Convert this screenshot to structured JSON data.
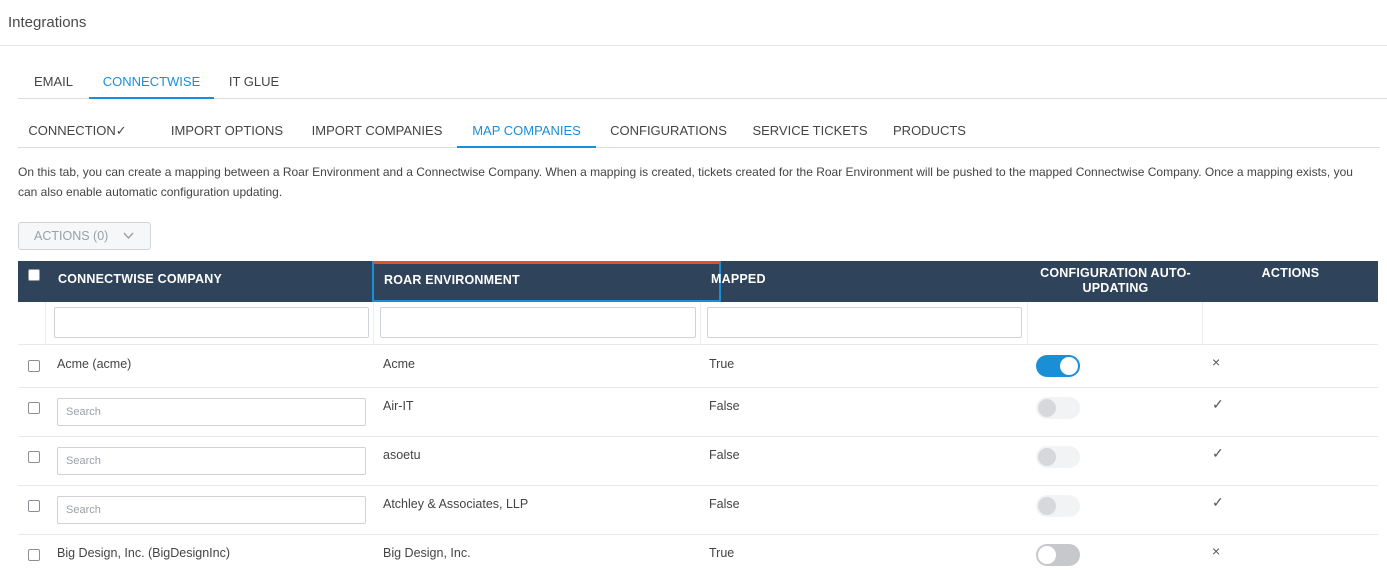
{
  "page": {
    "title": "Integrations"
  },
  "top_tabs": [
    {
      "label": "EMAIL",
      "active": false
    },
    {
      "label": "CONNECTWISE",
      "active": true
    },
    {
      "label": "IT GLUE",
      "active": false
    }
  ],
  "sub_tabs": [
    {
      "label": "CONNECTION✓",
      "active": false
    },
    {
      "label": "IMPORT OPTIONS",
      "active": false
    },
    {
      "label": "IMPORT COMPANIES",
      "active": false
    },
    {
      "label": "MAP COMPANIES",
      "active": true
    },
    {
      "label": "CONFIGURATIONS",
      "active": false
    },
    {
      "label": "SERVICE TICKETS",
      "active": false
    },
    {
      "label": "PRODUCTS",
      "active": false
    }
  ],
  "description": "On this tab, you can create a mapping between a Roar Environment and a Connectwise Company. When a mapping is created, tickets created for the Roar Environment will be pushed to the mapped Connectwise Company. Once a mapping exists, you can also enable automatic configuration updating.",
  "actions_button": {
    "label": "ACTIONS (0)",
    "icon": "chevron-down-icon"
  },
  "columns": {
    "company": "CONNECTWISE COMPANY",
    "roar": "ROAR ENVIRONMENT",
    "mapped": "MAPPED",
    "config_line1": "CONFIGURATION AUTO-",
    "config_line2": "UPDATING",
    "actions": "ACTIONS"
  },
  "filters": {
    "company": "",
    "roar": "",
    "mapped": ""
  },
  "rows": [
    {
      "company": "Acme (acme)",
      "search_placeholder": "",
      "roar": "Acme",
      "mapped": "True",
      "auto_update": "on",
      "action": "×",
      "action_icon": "close-icon"
    },
    {
      "company": "",
      "search_placeholder": "Search",
      "roar": "Air-IT",
      "mapped": "False",
      "auto_update": "disabled",
      "action": "✓",
      "action_icon": "check-icon"
    },
    {
      "company": "",
      "search_placeholder": "Search",
      "roar": "asoetu",
      "mapped": "False",
      "auto_update": "disabled",
      "action": "✓",
      "action_icon": "check-icon"
    },
    {
      "company": "",
      "search_placeholder": "Search",
      "roar": "Atchley & Associates, LLP",
      "mapped": "False",
      "auto_update": "disabled",
      "action": "✓",
      "action_icon": "check-icon"
    },
    {
      "company": "Big Design, Inc. (BigDesignInc)",
      "search_placeholder": "",
      "roar": "Big Design, Inc.",
      "mapped": "True",
      "auto_update": "off",
      "action": "×",
      "action_icon": "close-icon"
    }
  ],
  "colors": {
    "accent": "#1a8fd8",
    "header_bg": "#2f435a",
    "sort_indicator": "#e0541d"
  }
}
